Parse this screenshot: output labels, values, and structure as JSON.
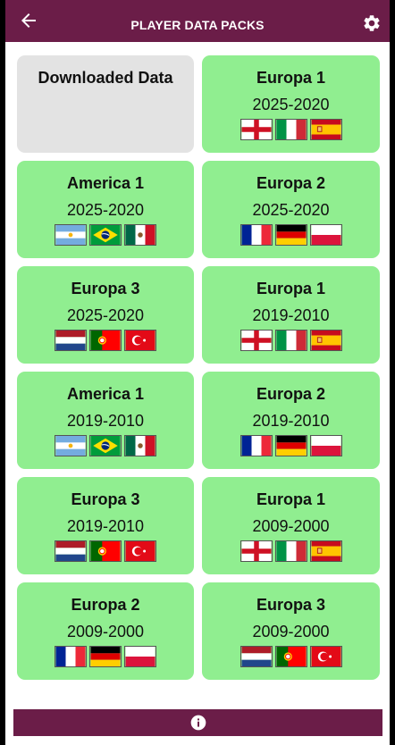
{
  "header": {
    "title": "PLAYER DATA PACKS",
    "back_icon": "arrow-left-icon",
    "settings_icon": "gear-icon"
  },
  "colors": {
    "bar": "#6b1d48",
    "card": "#90ee90",
    "card_disabled": "#e3e3e3"
  },
  "cards": [
    {
      "name": "Downloaded Data",
      "years": "",
      "flags": []
    },
    {
      "name": "Europa 1",
      "years": "2025-2020",
      "flags": [
        "england",
        "italy",
        "spain"
      ]
    },
    {
      "name": "America 1",
      "years": "2025-2020",
      "flags": [
        "argentina",
        "brazil",
        "mexico"
      ]
    },
    {
      "name": "Europa 2",
      "years": "2025-2020",
      "flags": [
        "france",
        "germany",
        "poland"
      ]
    },
    {
      "name": "Europa 3",
      "years": "2025-2020",
      "flags": [
        "netherlands",
        "portugal",
        "turkey"
      ]
    },
    {
      "name": "Europa 1",
      "years": "2019-2010",
      "flags": [
        "england",
        "italy",
        "spain"
      ]
    },
    {
      "name": "America 1",
      "years": "2019-2010",
      "flags": [
        "argentina",
        "brazil",
        "mexico"
      ]
    },
    {
      "name": "Europa 2",
      "years": "2019-2010",
      "flags": [
        "france",
        "germany",
        "poland"
      ]
    },
    {
      "name": "Europa 3",
      "years": "2019-2010",
      "flags": [
        "netherlands",
        "portugal",
        "turkey"
      ]
    },
    {
      "name": "Europa 1",
      "years": "2009-2000",
      "flags": [
        "england",
        "italy",
        "spain"
      ]
    },
    {
      "name": "Europa 2",
      "years": "2009-2000",
      "flags": [
        "france",
        "germany",
        "poland"
      ]
    },
    {
      "name": "Europa 3",
      "years": "2009-2000",
      "flags": [
        "netherlands",
        "portugal",
        "turkey"
      ]
    }
  ],
  "footer": {
    "info_icon": "info-icon"
  }
}
